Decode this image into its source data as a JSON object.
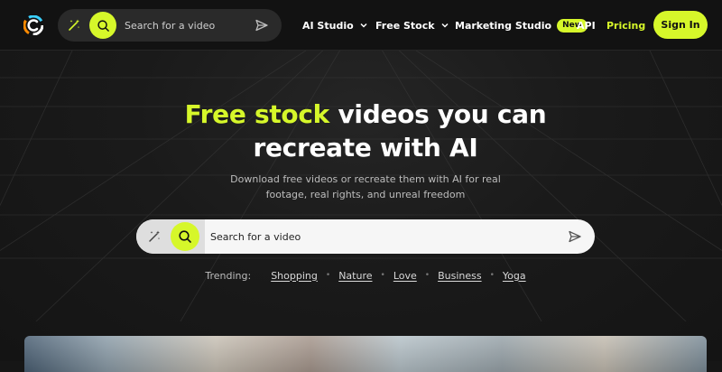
{
  "header": {
    "logo": "logo",
    "search": {
      "placeholder": "Search for a video",
      "icons": [
        "magic-wand-icon",
        "search-icon",
        "send-icon"
      ]
    },
    "nav": [
      {
        "label": "AI Studio",
        "dropdown": true
      },
      {
        "label": "Free Stock",
        "dropdown": true
      },
      {
        "label": "Marketing Studio",
        "badge": "New"
      },
      {
        "label": "API"
      },
      {
        "label": "Pricing"
      }
    ],
    "signin_label": "Sign In"
  },
  "hero": {
    "title_highlight": "Free stock",
    "title_rest_1": " videos you can",
    "title_rest_2": "recreate with AI",
    "subtitle": "Download free videos or recreate them with AI for real footage, real rights, and unreal freedom",
    "search": {
      "placeholder": "Search for a video"
    },
    "trending_label": "Trending:",
    "trending": [
      "Shopping",
      "Nature",
      "Love",
      "Business",
      "Yoga"
    ]
  },
  "colors": {
    "accent": "#d6f72a",
    "background": "#161616",
    "topbar": "#121212"
  }
}
